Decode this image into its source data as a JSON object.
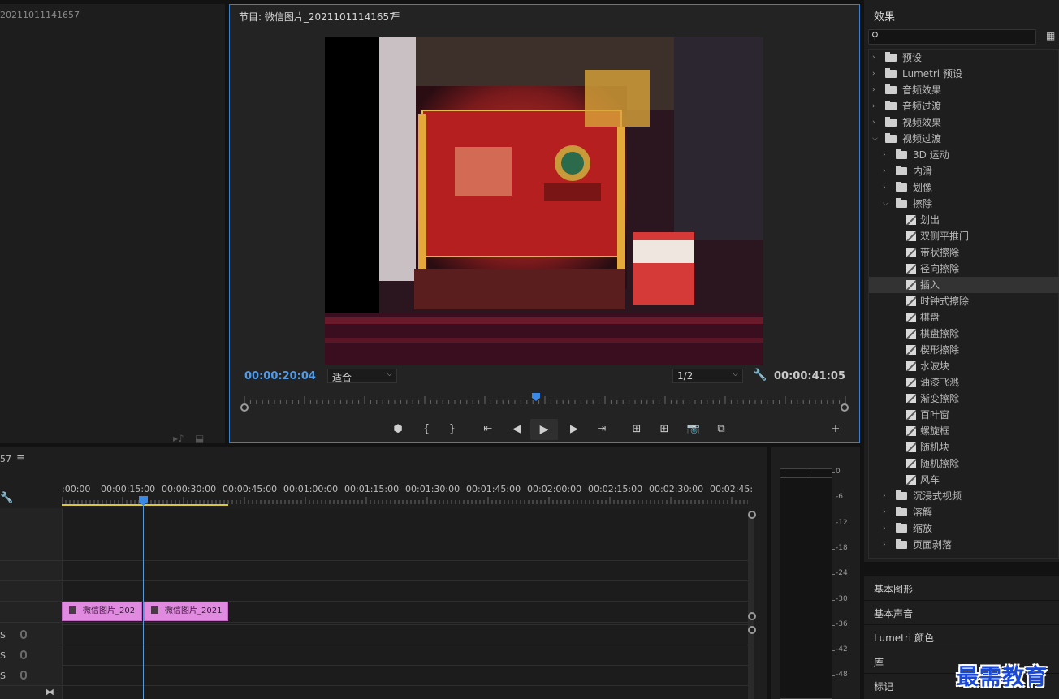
{
  "source": {
    "title": "20211011141657",
    "icons": [
      "insert-icon",
      "export-frame-icon"
    ]
  },
  "program": {
    "title": "节目: 微信图片_20211011141657",
    "menu_icon": "hamburger-icon",
    "timecode_current": "00:00:20:04",
    "timecode_duration": "00:00:41:05",
    "zoom": "适合",
    "resolution": "1/2",
    "playhead_fraction": 0.49,
    "transport": [
      {
        "name": "add-marker-button",
        "glyph": "⬢"
      },
      {
        "name": "mark-in-button",
        "glyph": "{"
      },
      {
        "name": "mark-out-button",
        "glyph": "}"
      },
      {
        "name": "go-to-in-button",
        "glyph": "⇤"
      },
      {
        "name": "step-back-button",
        "glyph": "◀"
      },
      {
        "name": "play-button",
        "glyph": "▶"
      },
      {
        "name": "step-forward-button",
        "glyph": "▶"
      },
      {
        "name": "go-to-out-button",
        "glyph": "⇥"
      },
      {
        "name": "lift-button",
        "glyph": "⊞"
      },
      {
        "name": "extract-button",
        "glyph": "⊞"
      },
      {
        "name": "export-frame-button",
        "glyph": "📷"
      },
      {
        "name": "compare-button",
        "glyph": "⧉"
      },
      {
        "name": "add-button",
        "glyph": "+"
      }
    ]
  },
  "effects": {
    "title": "效果",
    "tree": [
      {
        "label": "预设",
        "depth": 0,
        "kind": "preset",
        "expanded": false
      },
      {
        "label": "Lumetri 预设",
        "depth": 0,
        "kind": "preset",
        "expanded": false
      },
      {
        "label": "音频效果",
        "depth": 0,
        "kind": "folder",
        "expanded": false
      },
      {
        "label": "音频过渡",
        "depth": 0,
        "kind": "folder",
        "expanded": false
      },
      {
        "label": "视频效果",
        "depth": 0,
        "kind": "folder",
        "expanded": false
      },
      {
        "label": "视频过渡",
        "depth": 0,
        "kind": "folder",
        "expanded": true
      },
      {
        "label": "3D 运动",
        "depth": 1,
        "kind": "folder",
        "expanded": false
      },
      {
        "label": "内滑",
        "depth": 1,
        "kind": "folder",
        "expanded": false
      },
      {
        "label": "划像",
        "depth": 1,
        "kind": "folder",
        "expanded": false
      },
      {
        "label": "擦除",
        "depth": 1,
        "kind": "folder",
        "expanded": true
      },
      {
        "label": "划出",
        "depth": 2,
        "kind": "effect"
      },
      {
        "label": "双侧平推门",
        "depth": 2,
        "kind": "effect"
      },
      {
        "label": "带状擦除",
        "depth": 2,
        "kind": "effect"
      },
      {
        "label": "径向擦除",
        "depth": 2,
        "kind": "effect"
      },
      {
        "label": "插入",
        "depth": 2,
        "kind": "effect",
        "selected": true
      },
      {
        "label": "时钟式擦除",
        "depth": 2,
        "kind": "effect"
      },
      {
        "label": "棋盘",
        "depth": 2,
        "kind": "effect"
      },
      {
        "label": "棋盘擦除",
        "depth": 2,
        "kind": "effect"
      },
      {
        "label": "楔形擦除",
        "depth": 2,
        "kind": "effect"
      },
      {
        "label": "水波块",
        "depth": 2,
        "kind": "effect"
      },
      {
        "label": "油漆飞溅",
        "depth": 2,
        "kind": "effect"
      },
      {
        "label": "渐变擦除",
        "depth": 2,
        "kind": "effect"
      },
      {
        "label": "百叶窗",
        "depth": 2,
        "kind": "effect"
      },
      {
        "label": "螺旋框",
        "depth": 2,
        "kind": "effect"
      },
      {
        "label": "随机块",
        "depth": 2,
        "kind": "effect"
      },
      {
        "label": "随机擦除",
        "depth": 2,
        "kind": "effect"
      },
      {
        "label": "风车",
        "depth": 2,
        "kind": "effect"
      },
      {
        "label": "沉浸式视频",
        "depth": 1,
        "kind": "folder",
        "expanded": false
      },
      {
        "label": "溶解",
        "depth": 1,
        "kind": "folder",
        "expanded": false
      },
      {
        "label": "缩放",
        "depth": 1,
        "kind": "folder",
        "expanded": false
      },
      {
        "label": "页面剥落",
        "depth": 1,
        "kind": "folder",
        "expanded": false
      }
    ]
  },
  "side_panels": [
    "基本图形",
    "基本声音",
    "Lumetri 颜色",
    "库",
    "标记"
  ],
  "timeline": {
    "title": "57",
    "ruler": [
      ":00:00",
      "00:00:15:00",
      "00:00:30:00",
      "00:00:45:00",
      "00:01:00:00",
      "00:01:15:00",
      "00:01:30:00",
      "00:01:45:00",
      "00:02:00:00",
      "00:02:15:00",
      "00:02:30:00",
      "00:02:45:"
    ],
    "clips": [
      {
        "label": "微信图片_202",
        "color": "#e18be0"
      },
      {
        "label": "微信图片_2021",
        "color": "#e18be0"
      }
    ],
    "audio_tracks": [
      "S",
      "S",
      "S"
    ]
  },
  "audio_meter": {
    "scale": [
      "0",
      "-6",
      "-12",
      "-18",
      "-24",
      "-30",
      "-36",
      "-42",
      "-48"
    ]
  },
  "watermark": "最需教育"
}
